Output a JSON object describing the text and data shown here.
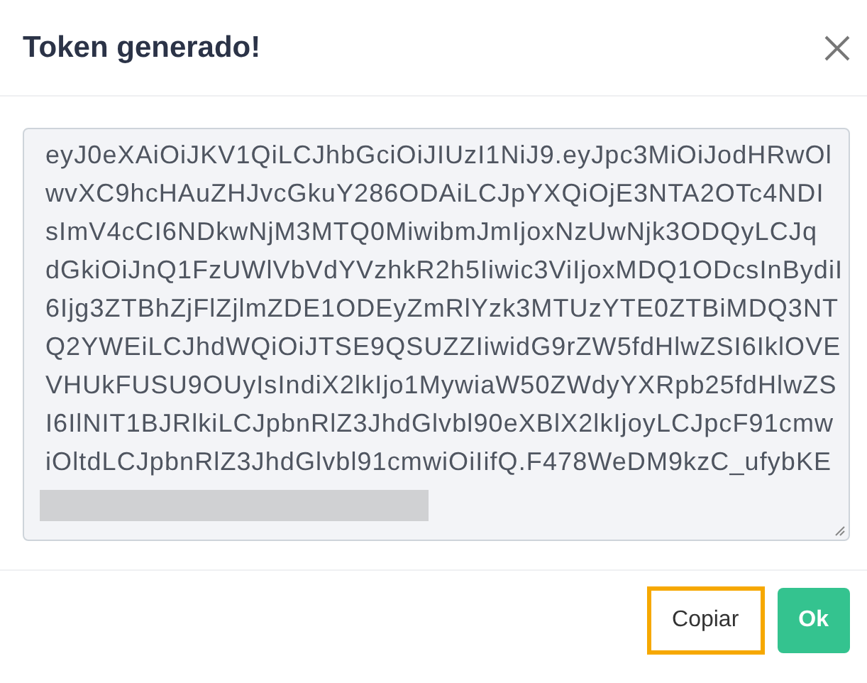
{
  "dialog": {
    "title": "Token generado!"
  },
  "token": {
    "lines": [
      "eyJ0eXAiOiJKV1QiLCJhbGciOiJIUzI1NiJ9.eyJpc3MiOiJodHRwOl",
      "wvXC9hcHAuZHJvcGkuY286ODAiLCJpYXQiOjE3NTA2OTc4NDI",
      "sImV4cCI6NDkwNjM3MTQ0MiwibmJmIjoxNzUwNjk3ODQyLCJq",
      "dGkiOiJnQ1FzUWlVbVdYVzhkR2h5Iiwic3ViIjoxMDQ1ODcsInBydiI",
      "6Ijg3ZTBhZjFlZjlmZDE1ODEyZmRlYzk3MTUzYTE0ZTBiMDQ3NT",
      "Q2YWEiLCJhdWQiOiJTSE9QSUZZIiwidG9rZW5fdHlwZSI6IklOVE",
      "VHUkFUSU9OUyIsIndiX2lkIjo1MywiaW50ZWdyYXRpb25fdHlwZS",
      "I6IlNIT1BJRlkiLCJpbnRlZ3JhdGlvbl90eXBlX2lkIjoyLCJpcF91cmw",
      "iOltdLCJpbnRlZ3JhdGlvbl91cmwiOiIifQ.F478WeDM9kzC_ufybKE"
    ],
    "redacted": true
  },
  "buttons": [
    {
      "label": "Copiar",
      "kind": "secondary",
      "focused": true
    },
    {
      "label": "Ok",
      "kind": "primary",
      "focused": false
    }
  ]
}
